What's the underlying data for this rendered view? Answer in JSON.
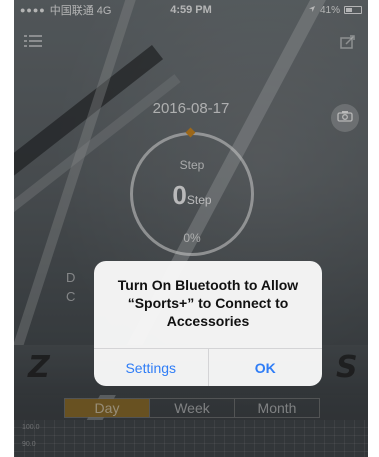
{
  "status_bar": {
    "signal": "●●●●",
    "carrier": "中国联通 4G",
    "time": "4:59 PM",
    "battery": "41%"
  },
  "main": {
    "date": "2016-08-17",
    "ring": {
      "title": "Step",
      "value": "0",
      "unit": "Step",
      "percent": "0%",
      "progress_fraction": 0
    },
    "edge_labels": [
      "D",
      "C"
    ],
    "logo_text_left": "Z",
    "logo_text_right": "S"
  },
  "tabs": [
    {
      "label": "Day",
      "active": true
    },
    {
      "label": "Week",
      "active": false
    },
    {
      "label": "Month",
      "active": false
    }
  ],
  "chart": {
    "y_ticks": [
      "100.0",
      "90.0"
    ]
  },
  "alert": {
    "message": "Turn On Bluetooth to Allow “Sports+” to Connect to Accessories",
    "settings_label": "Settings",
    "ok_label": "OK"
  },
  "colors": {
    "accent": "#8b6d2d",
    "ring_marker": "#d08a22",
    "alert_button": "#2f7df6"
  },
  "icons": {
    "menu": "menu-icon",
    "share": "share-icon",
    "camera": "camera-icon",
    "battery": "battery-icon",
    "location": "location-icon"
  }
}
